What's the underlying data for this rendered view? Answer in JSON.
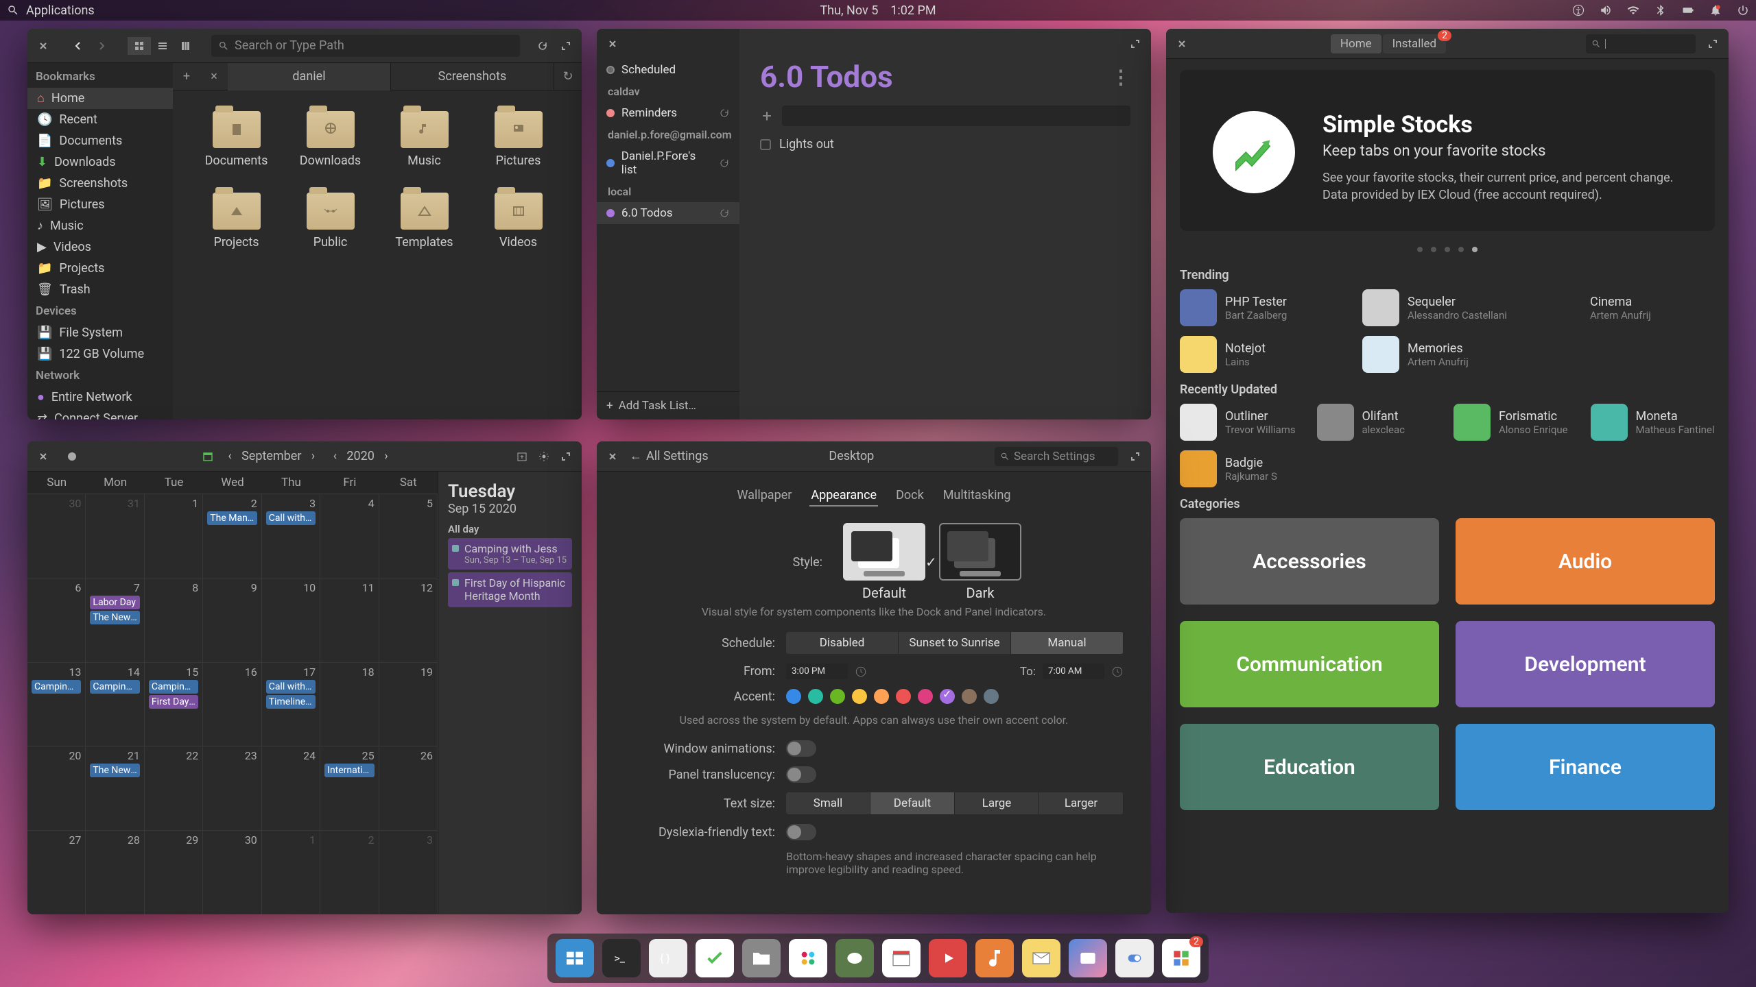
{
  "panel": {
    "apps_label": "Applications",
    "date": "Thu, Nov  5",
    "time": "1:02 PM"
  },
  "files": {
    "search_placeholder": "Search or Type Path",
    "tabs": [
      "daniel",
      "Screenshots"
    ],
    "sidebar": {
      "bookmarks_header": "Bookmarks",
      "bookmarks": [
        "Home",
        "Recent",
        "Documents",
        "Downloads",
        "Screenshots",
        "Pictures",
        "Music",
        "Videos",
        "Projects",
        "Trash"
      ],
      "devices_header": "Devices",
      "devices": [
        "File System",
        "122 GB Volume"
      ],
      "network_header": "Network",
      "network": [
        "Entire Network",
        "Connect Server"
      ]
    },
    "folders": [
      "Documents",
      "Downloads",
      "Music",
      "Pictures",
      "Projects",
      "Public",
      "Templates",
      "Videos"
    ]
  },
  "todos": {
    "scheduled": "Scheduled",
    "categories": {
      "caldav": "caldav",
      "reminders": "Reminders",
      "gmail": "daniel.p.fore@gmail.com",
      "fores_list": "Daniel.P.Fore's list",
      "local": "local",
      "six_todos": "6.0 Todos"
    },
    "title": "6.0 Todos",
    "items": [
      "Lights out"
    ],
    "add_list": "Add Task List…"
  },
  "appcenter": {
    "tabs": {
      "home": "Home",
      "installed": "Installed"
    },
    "installed_badge": "2",
    "hero": {
      "title": "Simple Stocks",
      "subtitle": "Keep tabs on your favorite stocks",
      "desc": "See your favorite stocks, their current price, and percent change. Data provided by IEX Cloud (free account required)."
    },
    "trending_header": "Trending",
    "trending": [
      {
        "name": "PHP Tester",
        "author": "Bart Zaalberg",
        "bg": "#5a6fb0"
      },
      {
        "name": "Sequeler",
        "author": "Alessandro Castellani",
        "bg": "#d0d0d0"
      },
      {
        "name": "Cinema",
        "author": "Artem Anufrij",
        "bg": "#2a2a2a"
      },
      {
        "name": "Notejot",
        "author": "Lains",
        "bg": "#f5d76e"
      },
      {
        "name": "Memories",
        "author": "Artem Anufrij",
        "bg": "#d9eaf5"
      }
    ],
    "recent_header": "Recently Updated",
    "recent": [
      {
        "name": "Outliner",
        "author": "Trevor Williams",
        "bg": "#e8e8e8"
      },
      {
        "name": "Olifant",
        "author": "alexcleac",
        "bg": "#888"
      },
      {
        "name": "Forismatic",
        "author": "Alonso Enrique",
        "bg": "#5ab963"
      },
      {
        "name": "Moneta",
        "author": "Matheus Fantinel",
        "bg": "#4ab8a8"
      },
      {
        "name": "Badgie",
        "author": "Rajkumar S",
        "bg": "#e8a030"
      }
    ],
    "categories_header": "Categories",
    "categories": [
      {
        "name": "Accessories",
        "bg": "#5a5a5a"
      },
      {
        "name": "Audio",
        "bg": "#e8803a"
      },
      {
        "name": "Communication",
        "bg": "#6db33f"
      },
      {
        "name": "Development",
        "bg": "#7a5fb0"
      },
      {
        "name": "Education",
        "bg": "#4a7a6a"
      },
      {
        "name": "Finance",
        "bg": "#3a8fd0"
      }
    ]
  },
  "calendar": {
    "month": "September",
    "year": "2020",
    "weekdays": [
      "Sun",
      "Mon",
      "Tue",
      "Wed",
      "Thu",
      "Fri",
      "Sat"
    ],
    "agenda": {
      "day": "Tuesday",
      "date": "Sep 15 2020",
      "allday_label": "All day",
      "events": [
        {
          "title": "Camping with Jess",
          "sub": "Sun, Sep 13 – Tue, Sep 15",
          "sel": true
        },
        {
          "title": "First Day of Hispanic Heritage Month",
          "sub": "",
          "sel": true
        }
      ]
    },
    "cells": [
      [
        {
          "n": "30",
          "o": 1
        },
        {
          "n": "31",
          "o": 1
        },
        {
          "n": "1",
          "ev": []
        },
        {
          "n": "2",
          "ev": [
            {
              "t": "The Man…",
              "c": "blue"
            }
          ]
        },
        {
          "n": "3",
          "ev": [
            {
              "t": "Call with …",
              "c": "blue"
            }
          ]
        },
        {
          "n": "4"
        },
        {
          "n": "5"
        }
      ],
      [
        {
          "n": "6"
        },
        {
          "n": "7",
          "ev": [
            {
              "t": "Labor Day",
              "c": "purple"
            },
            {
              "t": "The New …",
              "c": "blue"
            }
          ]
        },
        {
          "n": "8"
        },
        {
          "n": "9"
        },
        {
          "n": "10"
        },
        {
          "n": "11"
        },
        {
          "n": "12"
        }
      ],
      [
        {
          "n": "13",
          "ev": [
            {
              "t": "Camping …",
              "c": "blue"
            }
          ]
        },
        {
          "n": "14",
          "ev": [
            {
              "t": "Camping …",
              "c": "blue"
            }
          ]
        },
        {
          "n": "15",
          "ev": [
            {
              "t": "Camping …",
              "c": "blue"
            },
            {
              "t": "First Day …",
              "c": "purple"
            }
          ]
        },
        {
          "n": "16"
        },
        {
          "n": "17",
          "ev": [
            {
              "t": "Call with …",
              "c": "blue"
            },
            {
              "t": "Timeline …",
              "c": "blue"
            }
          ]
        },
        {
          "n": "18"
        },
        {
          "n": "19"
        }
      ],
      [
        {
          "n": "20"
        },
        {
          "n": "21",
          "ev": [
            {
              "t": "The New …",
              "c": "blue"
            }
          ]
        },
        {
          "n": "22"
        },
        {
          "n": "23"
        },
        {
          "n": "24"
        },
        {
          "n": "25",
          "ev": [
            {
              "t": "Internatio…",
              "c": "blue"
            }
          ]
        },
        {
          "n": "26"
        }
      ],
      [
        {
          "n": "27"
        },
        {
          "n": "28"
        },
        {
          "n": "29"
        },
        {
          "n": "30"
        },
        {
          "n": "1",
          "o": 1
        },
        {
          "n": "2",
          "o": 1
        },
        {
          "n": "3",
          "o": 1
        }
      ]
    ]
  },
  "settings": {
    "all_settings": "All Settings",
    "title": "Desktop",
    "search_placeholder": "Search Settings",
    "tabs": [
      "Wallpaper",
      "Appearance",
      "Dock",
      "Multitasking"
    ],
    "style_label": "Style:",
    "style_default": "Default",
    "style_dark": "Dark",
    "style_hint": "Visual style for system components like the Dock and Panel indicators.",
    "schedule_label": "Schedule:",
    "schedule_opts": [
      "Disabled",
      "Sunset to Sunrise",
      "Manual"
    ],
    "from_label": "From:",
    "from_value": "3:00 PM",
    "to_label": "To:",
    "to_value": "7:00 AM",
    "accent_label": "Accent:",
    "accent_colors": [
      "#3689e6",
      "#28bca3",
      "#68b723",
      "#f9c440",
      "#ffa154",
      "#ed5353",
      "#de3e80",
      "#a56de2",
      "#8a715e",
      "#667885"
    ],
    "accent_hint": "Used across the system by default. Apps can always use their own accent color.",
    "winanim_label": "Window animations:",
    "panel_label": "Panel translucency:",
    "textsize_label": "Text size:",
    "textsize_opts": [
      "Small",
      "Default",
      "Large",
      "Larger"
    ],
    "dyslexia_label": "Dyslexia-friendly text:",
    "dyslexia_hint": "Bottom-heavy shapes and increased character spacing can help improve legibility and reading speed."
  },
  "dock": {
    "items": [
      "multitasking",
      "terminal",
      "code",
      "tasks",
      "files",
      "slack",
      "gimp",
      "calendar",
      "youtube",
      "music",
      "mail",
      "photos",
      "tweaks",
      "appcenter"
    ],
    "badge": "2"
  }
}
